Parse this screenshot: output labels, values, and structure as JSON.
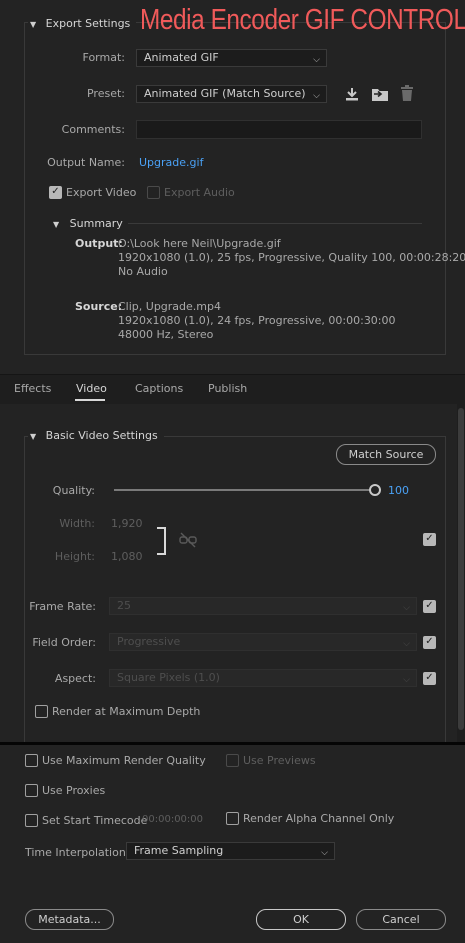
{
  "overlay_title": "Media Encoder GIF CONTROLS",
  "export": {
    "section_title": "Export Settings",
    "format_label": "Format:",
    "format_value": "Animated GIF",
    "preset_label": "Preset:",
    "preset_value": "Animated GIF (Match Source)",
    "comments_label": "Comments:",
    "comments_value": "",
    "output_name_label": "Output Name:",
    "output_name_value": "Upgrade.gif",
    "export_video_label": "Export Video",
    "export_video_checked": true,
    "export_audio_label": "Export Audio",
    "export_audio_checked": false
  },
  "summary": {
    "title": "Summary",
    "output_label": "Output:",
    "output_lines": [
      "O:\\Look here Neil\\Upgrade.gif",
      "1920x1080 (1.0), 25 fps, Progressive, Quality 100, 00:00:28:20",
      "No Audio"
    ],
    "source_label": "Source:",
    "source_lines": [
      "Clip, Upgrade.mp4",
      "1920x1080 (1.0), 24 fps, Progressive, 00:00:30:00",
      "48000 Hz, Stereo"
    ]
  },
  "tabs": [
    {
      "label": "Effects",
      "active": false
    },
    {
      "label": "Video",
      "active": true
    },
    {
      "label": "Captions",
      "active": false
    },
    {
      "label": "Publish",
      "active": false
    }
  ],
  "video": {
    "section_title": "Basic Video Settings",
    "match_source_label": "Match Source",
    "quality_label": "Quality:",
    "quality_value": "100",
    "quality_fraction": 1.0,
    "width_label": "Width:",
    "width_value": "1,920",
    "height_label": "Height:",
    "height_value": "1,080",
    "frame_rate_label": "Frame Rate:",
    "frame_rate_value": "25",
    "field_order_label": "Field Order:",
    "field_order_value": "Progressive",
    "aspect_label": "Aspect:",
    "aspect_value": "Square Pixels (1.0)",
    "render_max_depth_label": "Render at Maximum Depth"
  },
  "bottom": {
    "use_max_render_quality": "Use Maximum Render Quality",
    "use_previews": "Use Previews",
    "use_proxies": "Use Proxies",
    "set_start_timecode": "Set Start Timecode",
    "start_timecode_value": "00:00:00:00",
    "render_alpha_only": "Render Alpha Channel Only",
    "time_interpolation_label": "Time Interpolation:",
    "time_interpolation_value": "Frame Sampling"
  },
  "footer": {
    "metadata_label": "Metadata...",
    "ok_label": "OK",
    "cancel_label": "Cancel"
  },
  "colors": {
    "accent": "#4aa1f5",
    "overlay_title": "#f05a5a",
    "background": "#232323"
  }
}
